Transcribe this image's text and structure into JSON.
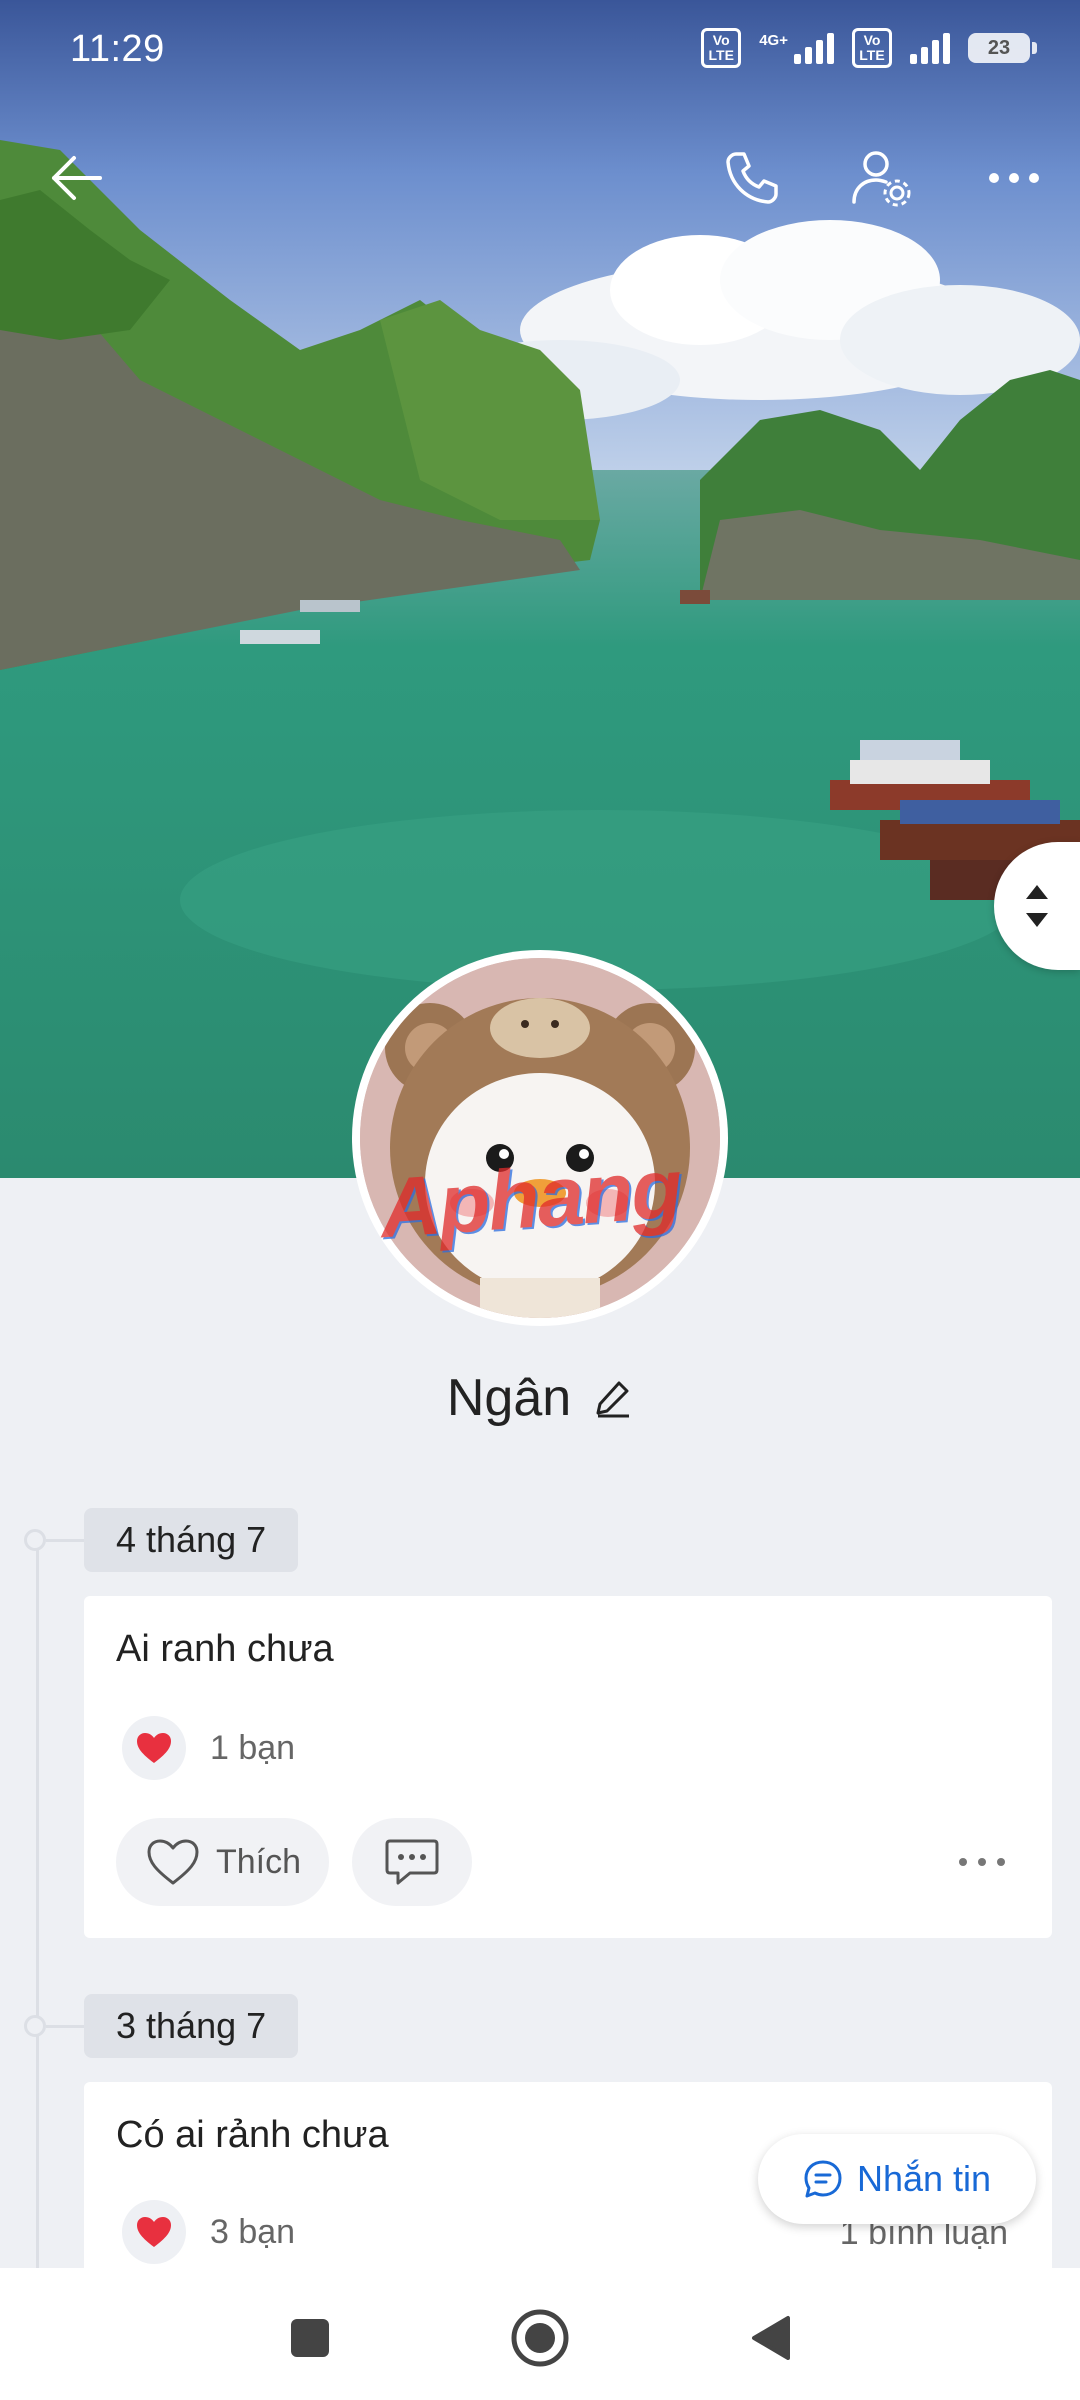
{
  "status_bar": {
    "time": "11:29",
    "volte1": "Vo LTE",
    "network": "4G+",
    "volte2": "Vo LTE",
    "battery": "23"
  },
  "header": {
    "icons": [
      "back-arrow-icon",
      "phone-icon",
      "user-settings-icon",
      "more-icon"
    ]
  },
  "profile": {
    "name": "Ngân",
    "avatar_watermark": "Aphang"
  },
  "posts": [
    {
      "date": "4 tháng 7",
      "text": "Ai ranh chưa",
      "reactions": "1 bạn",
      "like_label": "Thích"
    },
    {
      "date": "3 tháng 7",
      "text": "Có ai rảnh chưa",
      "reactions": "3 bạn",
      "comments": "1 bình luận"
    }
  ],
  "message_button": {
    "label": "Nhắn tin"
  },
  "colors": {
    "accent": "#1869d6",
    "heart": "#e8303f",
    "background": "#eef0f4"
  }
}
